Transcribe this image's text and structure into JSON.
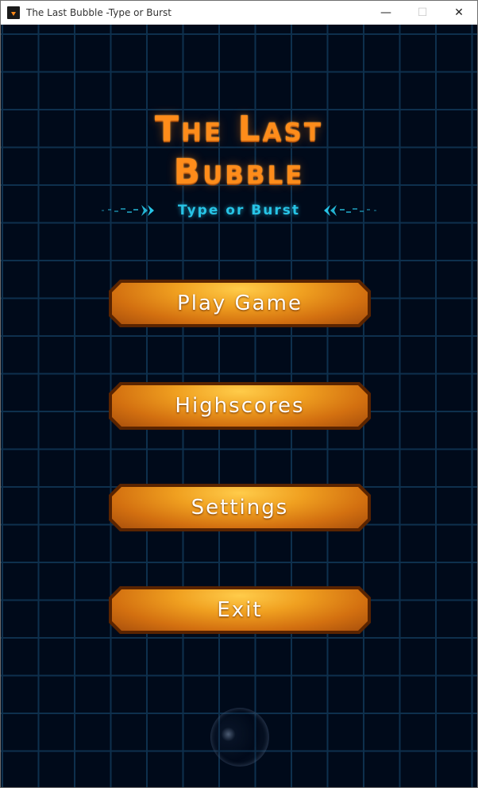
{
  "window": {
    "title": "The Last Bubble -Type or Burst",
    "icon": "app-bubble-icon",
    "controls": {
      "minimize": "—",
      "maximize": "☐",
      "close": "✕"
    }
  },
  "game": {
    "logo": {
      "line1": "The Last",
      "line2": "Bubble"
    },
    "subtitle": "Type or Burst",
    "menu": {
      "play": "Play Game",
      "highscores": "Highscores",
      "settings": "Settings",
      "exit": "Exit"
    }
  },
  "colors": {
    "background": "#000a1a",
    "grid": "#0f3350",
    "logo": "#ff8c1a",
    "subtitle": "#27c4e6",
    "button": "#e08a18"
  }
}
